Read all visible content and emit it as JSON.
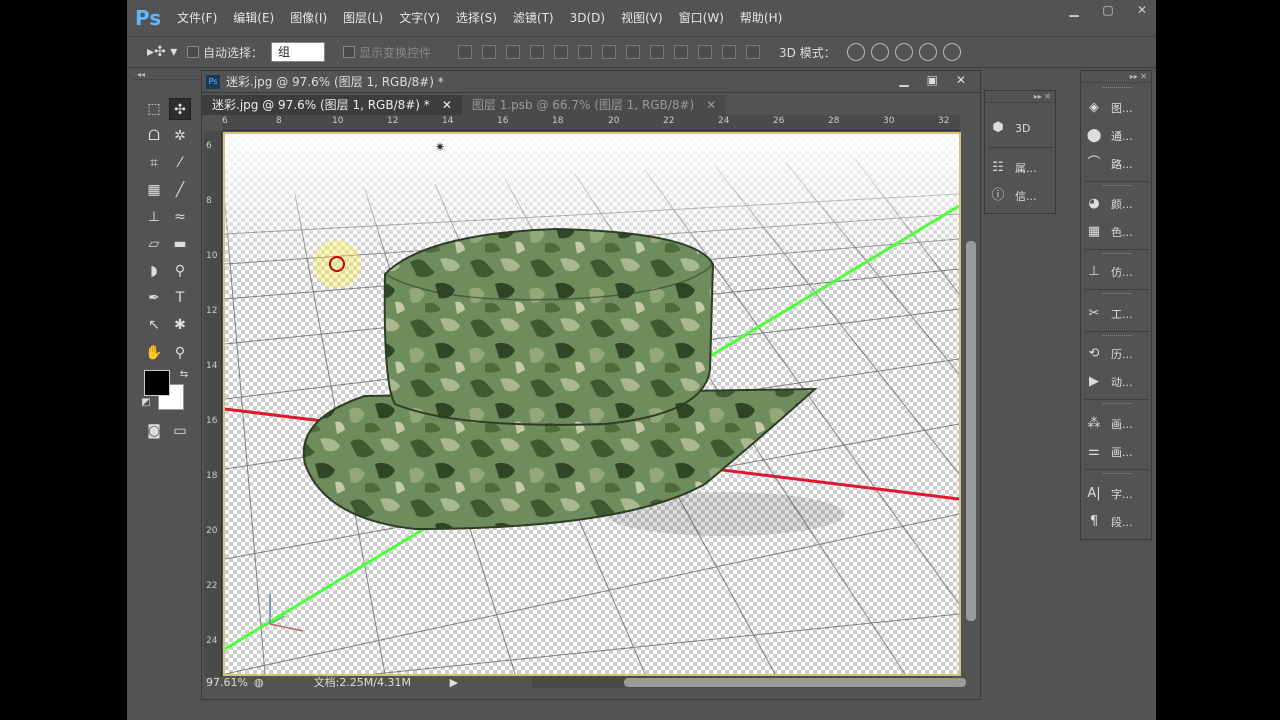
{
  "menubar": {
    "logo": "Ps",
    "items": [
      "文件(F)",
      "编辑(E)",
      "图像(I)",
      "图层(L)",
      "文字(Y)",
      "选择(S)",
      "滤镜(T)",
      "3D(D)",
      "视图(V)",
      "窗口(W)",
      "帮助(H)"
    ]
  },
  "options": {
    "auto_select_label": "自动选择：",
    "auto_select_value": "组",
    "show_transform_label": "显示变换控件",
    "mode3d_label": "3D 模式："
  },
  "document": {
    "title": "迷彩.jpg @ 97.6% (图层 1, RGB/8#) *",
    "tabs": [
      {
        "label": "迷彩.jpg @ 97.6% (图层 1, RGB/8#) *",
        "active": true
      },
      {
        "label": "图层 1.psb @ 66.7% (图层 1, RGB/8#)",
        "active": false
      }
    ],
    "ruler_top": [
      "6",
      "8",
      "10",
      "12",
      "14",
      "16",
      "18",
      "20",
      "22",
      "24",
      "26",
      "28",
      "30",
      "32"
    ],
    "ruler_left": [
      "6",
      "8",
      "10",
      "12",
      "14",
      "16",
      "18",
      "20",
      "22",
      "24"
    ],
    "zoom": "97.61%",
    "doc_info": "文档:2.25M/4.31M"
  },
  "mid_panel": {
    "items": [
      {
        "icon": "cube-icon",
        "label": "3D"
      },
      {
        "icon": "properties-icon",
        "label": "属..."
      },
      {
        "icon": "info-icon",
        "label": "信..."
      }
    ]
  },
  "right_panel": {
    "groups": [
      [
        {
          "icon": "layers-icon",
          "label": "图..."
        },
        {
          "icon": "channels-icon",
          "label": "通..."
        },
        {
          "icon": "paths-icon",
          "label": "路..."
        }
      ],
      [
        {
          "icon": "color-icon",
          "label": "颜..."
        },
        {
          "icon": "swatches-icon",
          "label": "色..."
        }
      ],
      [
        {
          "icon": "clone-source-icon",
          "label": "仿..."
        }
      ],
      [
        {
          "icon": "tool-presets-icon",
          "label": "工..."
        }
      ],
      [
        {
          "icon": "history-icon",
          "label": "历..."
        },
        {
          "icon": "actions-icon",
          "label": "动..."
        }
      ],
      [
        {
          "icon": "brush-icon",
          "label": "画..."
        },
        {
          "icon": "brush-presets-icon",
          "label": "画..."
        }
      ],
      [
        {
          "icon": "character-icon",
          "label": "字..."
        },
        {
          "icon": "paragraph-icon",
          "label": "段..."
        }
      ]
    ]
  }
}
